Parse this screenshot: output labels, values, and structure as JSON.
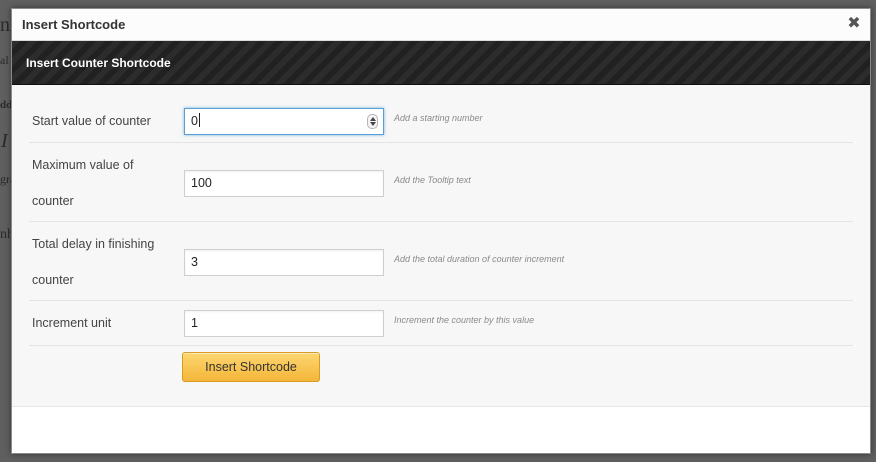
{
  "dialog": {
    "title": "Insert Shortcode",
    "close_label": "✖"
  },
  "panel": {
    "title": "Insert Counter Shortcode"
  },
  "form": {
    "fields": [
      {
        "label": "Start value of counter",
        "value": "0",
        "hint": "Add a starting number"
      },
      {
        "label": "Maximum value of counter",
        "value": "100",
        "hint": "Add the Tooltip text"
      },
      {
        "label": "Total delay in finishing counter",
        "value": "3",
        "hint": "Add the total duration of counter increment"
      },
      {
        "label": "Increment unit",
        "value": "1",
        "hint": "Increment the counter by this value"
      }
    ],
    "submit_label": "Insert Shortcode"
  },
  "background_fragments": [
    "nı",
    "al",
    "dd",
    "I",
    "gra",
    "nh"
  ],
  "colors": {
    "button_top": "#fdd670",
    "button_bottom": "#f4b63a",
    "header_bg": "#252525",
    "focus_border": "#5b9dd9"
  }
}
